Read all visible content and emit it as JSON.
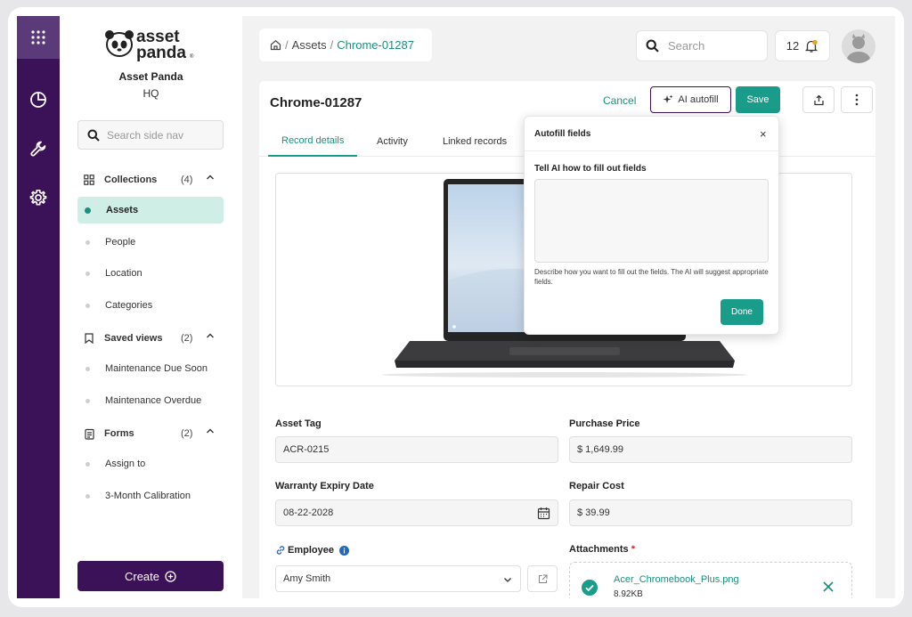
{
  "brand": {
    "logo_line1": "asset",
    "logo_line2": "panda",
    "org_name": "Asset Panda",
    "org_sub": "HQ"
  },
  "colors": {
    "rail": "#3b1158",
    "accent": "#1a9c8a",
    "active_bg": "#cfeee6"
  },
  "rail": {
    "icons": [
      "grid-icon",
      "chart-pie-icon",
      "wrench-icon",
      "gear-icon"
    ]
  },
  "sidenav": {
    "search_placeholder": "Search side nav",
    "groups": [
      {
        "label": "Collections",
        "count": "(4)",
        "icon": "grid-icon",
        "items": [
          "Assets",
          "People",
          "Location",
          "Categories"
        ]
      },
      {
        "label": "Saved views",
        "count": "(2)",
        "icon": "bookmark-icon",
        "items": [
          "Maintenance Due Soon",
          "Maintenance Overdue"
        ]
      },
      {
        "label": "Forms",
        "count": "(2)",
        "icon": "clipboard-icon",
        "items": [
          "Assign to",
          "3-Month Calibration"
        ]
      }
    ],
    "active_item": "Assets",
    "create_label": "Create"
  },
  "breadcrumb": {
    "root": "Assets",
    "current": "Chrome-01287"
  },
  "topbar": {
    "search_placeholder": "Search",
    "notification_count": "12"
  },
  "record": {
    "title": "Chrome-01287",
    "cancel_label": "Cancel",
    "ai_label": "AI autofill",
    "save_label": "Save",
    "tabs": [
      "Record details",
      "Activity",
      "Linked records"
    ],
    "active_tab": "Record details"
  },
  "fields": {
    "asset_tag": {
      "label": "Asset Tag",
      "value": "ACR-0215"
    },
    "purchase_price": {
      "label": "Purchase Price",
      "value": "$ 1,649.99"
    },
    "warranty": {
      "label": "Warranty Expiry Date",
      "value": "08-22-2028"
    },
    "repair_cost": {
      "label": "Repair Cost",
      "value": "$ 39.99"
    },
    "employee": {
      "label": "Employee",
      "value": "Amy Smith"
    },
    "attachments": {
      "label": "Attachments",
      "required_mark": "*",
      "file_name": "Acer_Chromebook_Plus.png",
      "file_size": "8.92KB"
    }
  },
  "autofill": {
    "title": "Autofill fields",
    "prompt_label": "Tell AI how to fill out fields",
    "help_text": "Describe how you want to fill out the fields. The AI will suggest appropriate fields.",
    "done_label": "Done"
  }
}
